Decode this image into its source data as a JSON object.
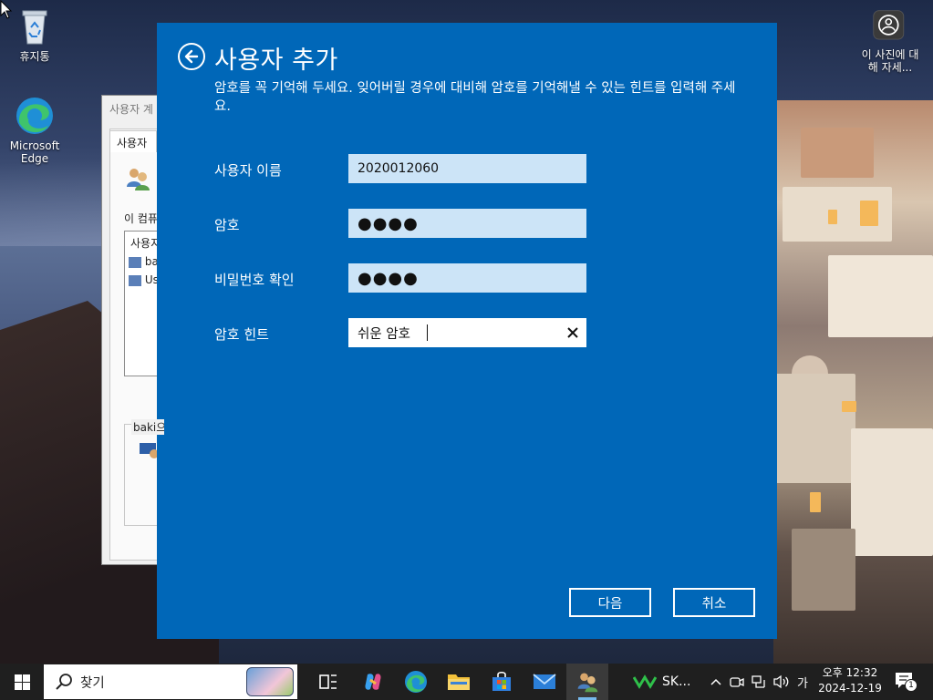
{
  "desktop": {
    "icons": [
      {
        "label": "휴지통"
      },
      {
        "label": "Microsoft Edge"
      },
      {
        "label": "이 사진에 대해 자세..."
      }
    ]
  },
  "background_window": {
    "title": "사용자 계",
    "tab": "사용자",
    "computer_label": "이 컴퓨",
    "list_header": "사용지",
    "list_items": [
      "ba",
      "Us"
    ],
    "group_label": "baki으"
  },
  "dialog": {
    "title": "사용자 추가",
    "description": "암호를 꼭 기억해 두세요. 잊어버릴 경우에 대비해 암호를 기억해낼 수 있는 힌트를 입력해 주세요.",
    "fields": {
      "username": {
        "label": "사용자 이름",
        "value": "2020012060"
      },
      "password": {
        "label": "암호",
        "value": "●●●●"
      },
      "confirm": {
        "label": "비밀번호 확인",
        "value": "●●●●"
      },
      "hint": {
        "label": "암호 힌트",
        "value": "쉬운 암호"
      }
    },
    "buttons": {
      "next": "다음",
      "cancel": "취소"
    }
  },
  "taskbar": {
    "search_placeholder": "찾기",
    "sk_label": "SK...",
    "ime": "가",
    "time": "오후 12:32",
    "date": "2024-12-19",
    "notification_count": "1"
  },
  "colors": {
    "dialog_bg": "#0067b8",
    "input_bg": "#cce4f7",
    "taskbar_bg": "#1f1f1f"
  }
}
